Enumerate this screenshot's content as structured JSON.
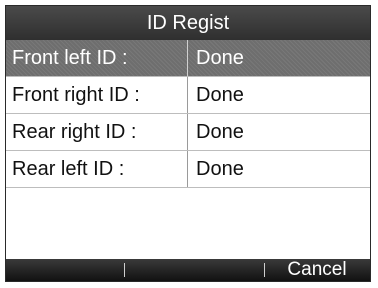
{
  "title": "ID Regist",
  "rows": [
    {
      "label": "Front  left  ID :",
      "value": "Done"
    },
    {
      "label": "Front right ID :",
      "value": "Done"
    },
    {
      "label": "Rear right ID :",
      "value": "Done"
    },
    {
      "label": "Rear  left   ID :",
      "value": "Done"
    }
  ],
  "softkeys": {
    "left": "",
    "middle": "",
    "right": "Cancel"
  }
}
